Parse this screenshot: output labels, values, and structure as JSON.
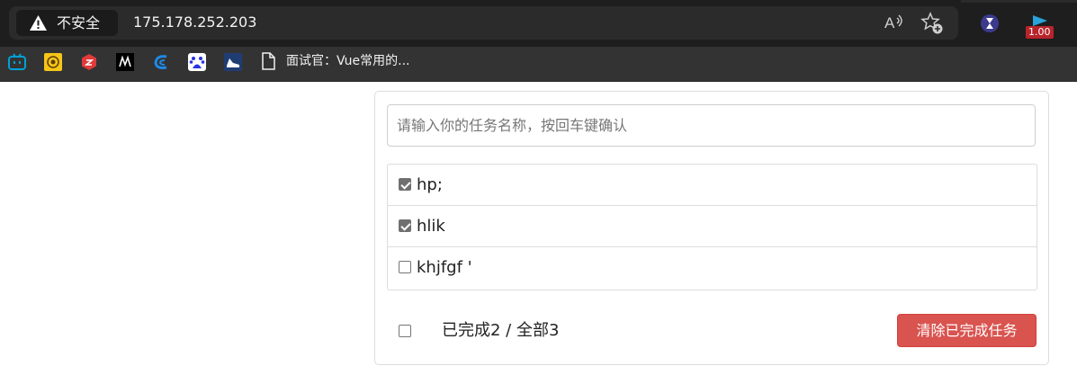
{
  "browser": {
    "security_label": "不安全",
    "url": "175.178.252.203",
    "extension_badge": "1.00",
    "icons": [
      "warning-icon",
      "read-aloud-icon",
      "add-favorite-icon",
      "timer-extension-icon",
      "player-extension-icon"
    ]
  },
  "bookmarks": {
    "items": [
      {
        "icon": "bilibili-icon",
        "color": "#00a1d6"
      },
      {
        "icon": "yellow-badge-icon",
        "color": "#f5c518"
      },
      {
        "icon": "red-cube-icon",
        "color": "#e03a3a"
      },
      {
        "icon": "m-logo-icon",
        "color": "#000000"
      },
      {
        "icon": "blue-swirl-icon",
        "color": "#1e88e5"
      },
      {
        "icon": "baidu-icon",
        "color": "#2932e1"
      },
      {
        "icon": "shoe-icon",
        "color": "#3d6fb6"
      }
    ],
    "page_label": "面试官：Vue常用的..."
  },
  "todo": {
    "input_placeholder": "请输入你的任务名称，按回车键确认",
    "tasks": [
      {
        "label": "hp;",
        "done": true
      },
      {
        "label": "hlik",
        "done": true
      },
      {
        "label": "khjfgf '",
        "done": false
      }
    ],
    "select_all_checked": false,
    "summary": "已完成2 / 全部3",
    "clear_button": "清除已完成任务",
    "colors": {
      "danger": "#d9534f"
    }
  }
}
